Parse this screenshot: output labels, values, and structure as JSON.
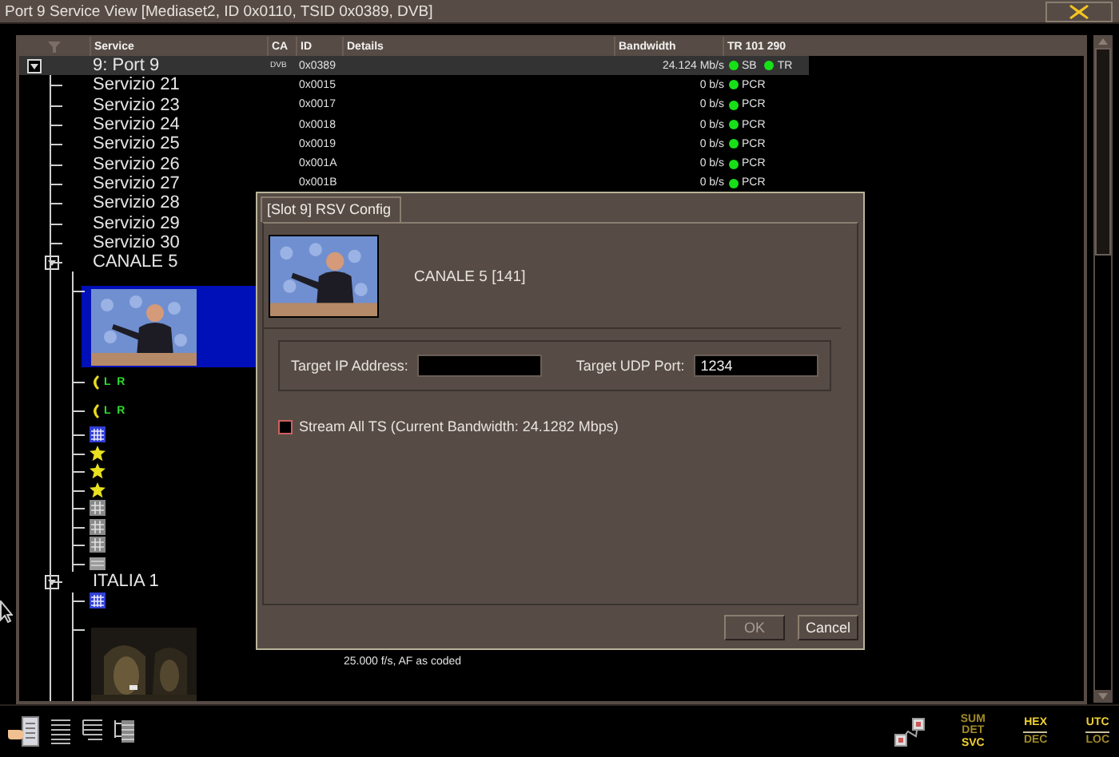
{
  "window": {
    "title": "Port 9 Service View  [Mediaset2, ID 0x0110, TSID 0x0389, DVB]"
  },
  "table": {
    "columns": [
      "Service",
      "CA",
      "ID",
      "Details",
      "Bandwidth",
      "TR 101 290"
    ],
    "tree": [
      {
        "kind": "port",
        "label": "9: Port 9",
        "expanded": true,
        "selected": false,
        "ca": "DVB",
        "id": "0x0389",
        "bandwidth": "24.124 Mb/s",
        "checks": [
          "SB",
          "TR"
        ],
        "children": [
          {
            "kind": "service",
            "label": "Servizio 21",
            "selected": false,
            "id": "0x0015",
            "bandwidth": "0 b/s",
            "checks": [
              "PCR"
            ]
          },
          {
            "kind": "service",
            "label": "Servizio 23",
            "selected": false,
            "id": "0x0017",
            "bandwidth": "0 b/s",
            "checks": [
              "PCR"
            ]
          },
          {
            "kind": "service",
            "label": "Servizio 24",
            "selected": false,
            "id": "0x0018",
            "bandwidth": "0 b/s",
            "checks": [
              "PCR"
            ]
          },
          {
            "kind": "service",
            "label": "Servizio 25",
            "selected": false,
            "id": "0x0019",
            "bandwidth": "0 b/s",
            "checks": [
              "PCR"
            ]
          },
          {
            "kind": "service",
            "label": "Servizio 26",
            "selected": false,
            "id": "0x001A",
            "bandwidth": "0 b/s",
            "checks": [
              "PCR"
            ]
          },
          {
            "kind": "service",
            "label": "Servizio 27",
            "selected": false,
            "id": "0x001B",
            "bandwidth": "0 b/s",
            "checks": [
              "PCR"
            ]
          },
          {
            "kind": "service",
            "label": "Servizio 28",
            "selected": false
          },
          {
            "kind": "service",
            "label": "Servizio 29",
            "selected": false
          },
          {
            "kind": "service",
            "label": "Servizio 30",
            "selected": false
          },
          {
            "kind": "program",
            "label": "CANALE 5",
            "expanded": true,
            "selected": false,
            "children": [
              {
                "kind": "video",
                "selected": true
              },
              {
                "kind": "audio",
                "label": "L R",
                "selected": false
              },
              {
                "kind": "audio",
                "label": "L R",
                "selected": false
              },
              {
                "kind": "teletext",
                "selected": false
              },
              {
                "kind": "subtitle",
                "selected": false
              },
              {
                "kind": "subtitle",
                "selected": false
              },
              {
                "kind": "subtitle",
                "selected": false
              },
              {
                "kind": "data",
                "selected": false
              },
              {
                "kind": "data",
                "selected": false
              },
              {
                "kind": "data",
                "selected": false
              },
              {
                "kind": "other",
                "selected": false
              }
            ]
          },
          {
            "kind": "program",
            "label": "ITALIA 1",
            "expanded": true,
            "selected": false,
            "children": [
              {
                "kind": "teletext",
                "selected": false
              },
              {
                "kind": "video",
                "selected": false,
                "details": "25.000 f/s, AF as coded"
              }
            ]
          }
        ]
      }
    ]
  },
  "dialog": {
    "tab": {
      "label": "[Slot 9] RSV Config",
      "selected": true
    },
    "service_name": "CANALE 5 [141]",
    "target_ip": {
      "label": "Target IP Address:"
    },
    "target_udp_port": {
      "label": "Target UDP Port:",
      "value": "1234"
    },
    "stream_all": {
      "label": "Stream All TS (Current Bandwidth: 24.1282 Mbps)",
      "checked": false
    },
    "buttons": [
      {
        "label": "OK",
        "disabled": true
      },
      {
        "label": "Cancel",
        "disabled": false
      }
    ]
  },
  "toolbar": {
    "toggles": [
      {
        "options": [
          {
            "label": "SUM",
            "selected": false
          },
          {
            "label": "DET",
            "selected": false
          },
          {
            "label": "SVC",
            "selected": true
          }
        ]
      },
      {
        "options": [
          {
            "label": "HEX",
            "selected": true
          },
          {
            "label": "DEC",
            "selected": false
          }
        ]
      },
      {
        "options": [
          {
            "label": "UTC",
            "selected": true
          },
          {
            "label": "LOC",
            "selected": false
          }
        ]
      }
    ]
  }
}
